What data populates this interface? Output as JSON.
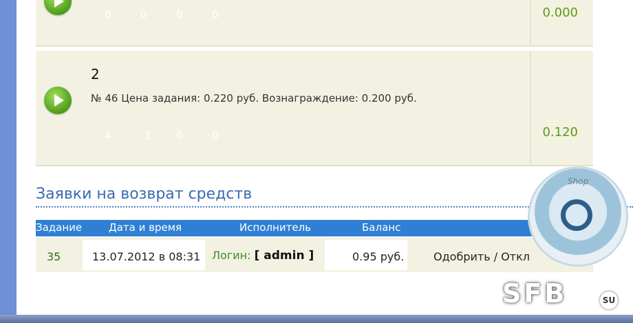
{
  "task1": {
    "stats": [
      "0",
      "0",
      "0",
      "0"
    ],
    "amount": "0.000"
  },
  "task2": {
    "number": "2",
    "details": "№ 46  Цена задания: 0.220 руб.  Вознаграждение: 0.200 руб.",
    "stats": [
      "4",
      "-1",
      "0",
      "0"
    ],
    "amount": "0.120"
  },
  "refunds": {
    "title": "Заявки на возврат средств",
    "headers": [
      "Задание",
      "Дата и время",
      "Исполнитель",
      "Баланс"
    ],
    "row": {
      "task": "35",
      "datetime": "13.07.2012 в 08:31",
      "login_label": "Логин:",
      "login_value": "[ admin ]",
      "balance": "0.95 руб.",
      "action": "Одобрить / Откл"
    }
  },
  "watermark": {
    "shop": "Shop",
    "logo": "SFB",
    "tld": "SU"
  },
  "colors": {
    "accent": "#2f80d4",
    "money": "#5a9a1a",
    "panel": "#f3f2e2",
    "title": "#3a6bb0"
  }
}
